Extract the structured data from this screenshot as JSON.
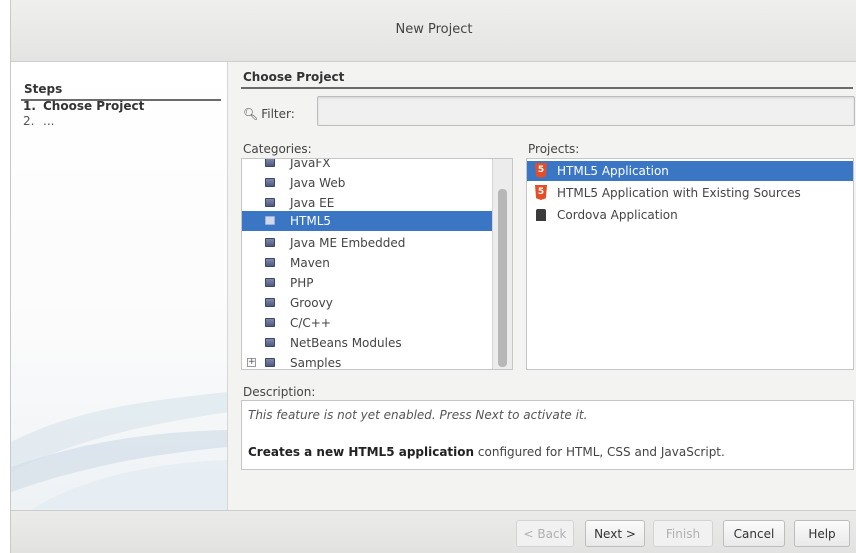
{
  "window": {
    "title": "New Project"
  },
  "steps": {
    "title": "Steps",
    "items": [
      {
        "num": "1.",
        "label": "Choose Project"
      },
      {
        "num": "2.",
        "label": "..."
      }
    ]
  },
  "main": {
    "section_title": "Choose Project",
    "filter": {
      "label": "Filter:",
      "value": ""
    },
    "categories": {
      "label": "Categories:",
      "items": [
        {
          "label": "JavaFX",
          "selected": false
        },
        {
          "label": "Java Web",
          "selected": false
        },
        {
          "label": "Java EE",
          "selected": false
        },
        {
          "label": "HTML5",
          "selected": true
        },
        {
          "label": "Java ME Embedded",
          "selected": false
        },
        {
          "label": "Maven",
          "selected": false
        },
        {
          "label": "PHP",
          "selected": false
        },
        {
          "label": "Groovy",
          "selected": false
        },
        {
          "label": "C/C++",
          "selected": false
        },
        {
          "label": "NetBeans Modules",
          "selected": false
        },
        {
          "label": "Samples",
          "selected": false,
          "expander": "+"
        }
      ]
    },
    "projects": {
      "label": "Projects:",
      "items": [
        {
          "label": "HTML5 Application",
          "icon": "html5-icon",
          "selected": true
        },
        {
          "label": "HTML5 Application with Existing Sources",
          "icon": "html5-icon",
          "selected": false
        },
        {
          "label": "Cordova Application",
          "icon": "cordova-icon",
          "selected": false
        }
      ]
    },
    "description": {
      "label": "Description:",
      "line1": "This feature is not yet enabled. Press Next to activate it.",
      "line2_bold": "Creates a new HTML5 application",
      "line2_rest": " configured for HTML, CSS and JavaScript."
    }
  },
  "buttons": {
    "back": "< Back",
    "next": "Next >",
    "finish": "Finish",
    "cancel": "Cancel",
    "help": "Help"
  },
  "colors": {
    "selection": "#3a76c4",
    "html5_icon": "#e44d26"
  }
}
